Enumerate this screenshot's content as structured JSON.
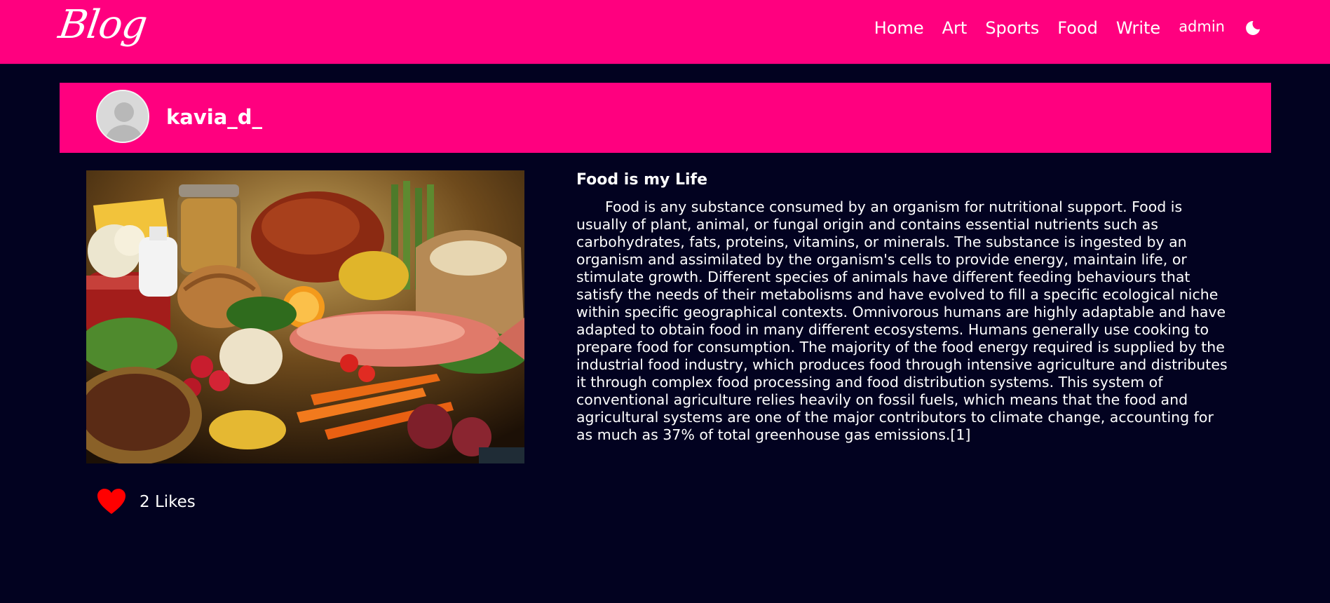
{
  "navbar": {
    "logo": "Blog",
    "links": [
      "Home",
      "Art",
      "Sports",
      "Food",
      "Write"
    ],
    "user": "admin",
    "theme_icon": "moon-icon"
  },
  "profile": {
    "username": "kavia_d_",
    "avatar_icon": "default-avatar-icon"
  },
  "post": {
    "image_icon": "food-photo",
    "title": "Food is my Life",
    "body": "Food is any substance consumed by an organism for nutritional support. Food is usually of plant, animal, or fungal origin and contains essential nutrients such as carbohydrates, fats, proteins, vitamins, or minerals. The substance is ingested by an organism and assimilated by the organism's cells to provide energy, maintain life, or stimulate growth. Different species of animals have different feeding behaviours that satisfy the needs of their metabolisms and have evolved to fill a specific ecological niche within specific geographical contexts. Omnivorous humans are highly adaptable and have adapted to obtain food in many different ecosystems. Humans generally use cooking to prepare food for consumption. The majority of the food energy required is supplied by the industrial food industry, which produces food through intensive agriculture and distributes it through complex food processing and food distribution systems. This system of conventional agriculture relies heavily on fossil fuels, which means that the food and agricultural systems are one of the major contributors to climate change, accounting for as much as 37% of total greenhouse gas emissions.[1]"
  },
  "likes": {
    "label": "2 Likes",
    "heart_icon": "heart-icon"
  },
  "colors": {
    "accent": "#ff007f",
    "background": "#020220",
    "heart": "#ff0000"
  }
}
